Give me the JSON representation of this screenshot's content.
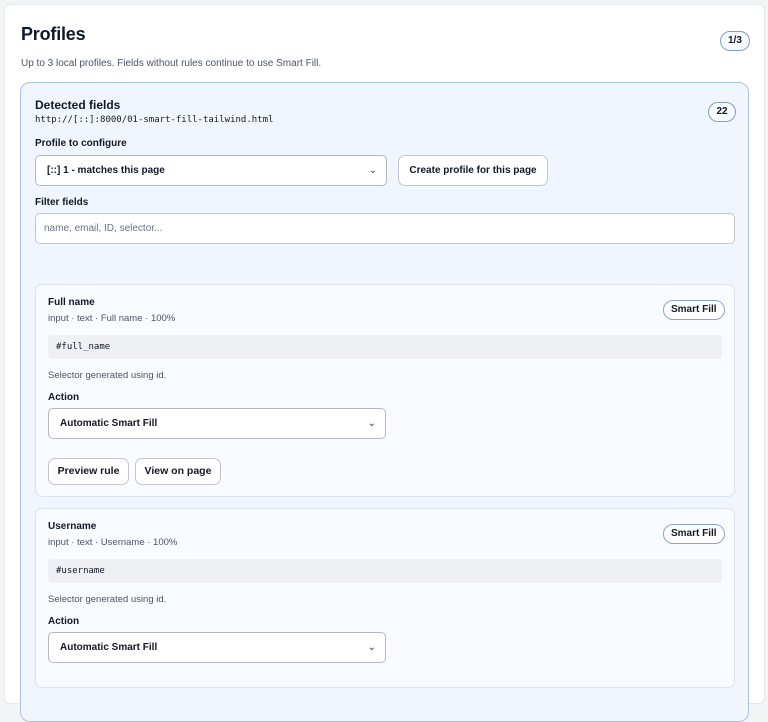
{
  "header": {
    "title": "Profiles",
    "badge": "1/3",
    "subtitle": "Up to 3 local profiles. Fields without rules continue to use Smart Fill."
  },
  "detected": {
    "title": "Detected fields",
    "url": "http://[::]:8000/01-smart-fill-tailwind.html",
    "count": "22",
    "profile_label": "Profile to configure",
    "profile_value": "[::] 1 - matches this page",
    "create_button": "Create profile for this page",
    "filter_label": "Filter fields",
    "filter_placeholder": "name, email, ID, selector..."
  },
  "fields": [
    {
      "title": "Full name",
      "meta": "input · text · Full name · 100%",
      "badge": "Smart Fill",
      "selector": "#full_name",
      "hint": "Selector generated using id.",
      "action_label": "Action",
      "action_value": "Automatic Smart Fill",
      "preview_button": "Preview rule",
      "view_button": "View on page"
    },
    {
      "title": "Username",
      "meta": "input · text · Username · 100%",
      "badge": "Smart Fill",
      "selector": "#username",
      "hint": "Selector generated using id.",
      "action_label": "Action",
      "action_value": "Automatic Smart Fill"
    }
  ],
  "icons": {
    "select_chevron": "chevron-down-icon"
  }
}
